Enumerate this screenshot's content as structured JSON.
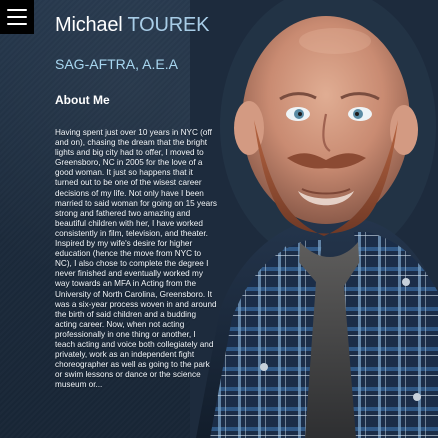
{
  "header": {
    "menu_icon": "hamburger-menu-icon",
    "first_name": "Michael",
    "last_name": "TOUREK",
    "credentials": "SAG-AFTRA, A.E.A"
  },
  "about": {
    "title": "About Me",
    "bio": "Having spent just over 10 years in NYC (off\nand on), chasing the dream that the bright\nlights and big city had to offer, I moved to\nGreensboro, NC in 2005 for the love of a\ngood woman. It just so happens that it\nturned out to be one of the wisest career\ndecisions of my life. Not only have I been\nmarried to said woman for going on 15 years\nstrong and fathered two amazing and\nbeautiful children with her, I have worked\nconsistently in film, television, and theater.\nInspired by my wife's desire for higher\neducation (hence the move from NYC to\nNC), I also chose to complete the degree I\nnever finished and eventually worked my\nway towards an MFA in Acting from the\nUniversity of North Carolina, Greensboro. It\nwas a six-year process woven in and around\nthe birth of said children and a budding\nacting career. Now, when not acting\nprofessionally in one thing or another, I\nteach acting and voice both collegiately and\nprivately, work as an independent fight\nchoreographer as well as going to the park\nor swim lessons or dance or the science\nmuseum or..."
  },
  "colors": {
    "background": "#1c2a3c",
    "accent_name": "#a8cde7",
    "accent_credentials": "#a8d7f0",
    "text": "#f4f7fb"
  }
}
